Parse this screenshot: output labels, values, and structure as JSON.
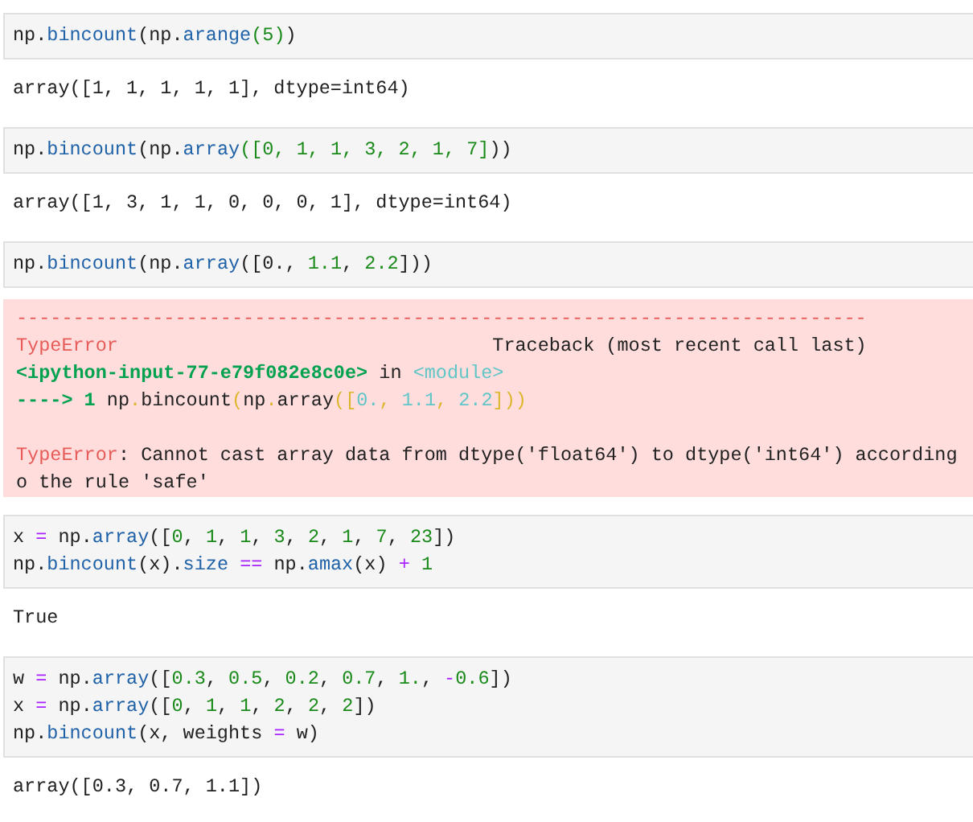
{
  "cells": [
    {
      "input": [
        [
          {
            "kind": "plain",
            "text": "np."
          },
          {
            "kind": "attr",
            "text": "bincount"
          },
          {
            "kind": "plain",
            "text": "(np."
          },
          {
            "kind": "attr",
            "text": "arange"
          },
          {
            "kind": "num",
            "text": "(5)"
          },
          {
            "kind": "plain",
            "text": ")"
          }
        ]
      ],
      "output": {
        "kind": "text",
        "lines": [
          [
            {
              "kind": "plain",
              "text": "array([1, 1, 1, 1, 1], dtype=int64)"
            }
          ]
        ]
      }
    },
    {
      "input": [
        [
          {
            "kind": "plain",
            "text": "np."
          },
          {
            "kind": "attr",
            "text": "bincount"
          },
          {
            "kind": "plain",
            "text": "(np."
          },
          {
            "kind": "attr",
            "text": "array"
          },
          {
            "kind": "num",
            "text": "([0, 1, 1, 3, 2, 1, 7]"
          },
          {
            "kind": "plain",
            "text": "))"
          }
        ]
      ],
      "output": {
        "kind": "text",
        "lines": [
          [
            {
              "kind": "plain",
              "text": "array([1, 3, 1, 1, 0, 0, 0, 1], dtype=int64)"
            }
          ]
        ]
      }
    },
    {
      "input": [
        [
          {
            "kind": "plain",
            "text": "np."
          },
          {
            "kind": "attr",
            "text": "bincount"
          },
          {
            "kind": "plain",
            "text": "(np."
          },
          {
            "kind": "attr",
            "text": "array"
          },
          {
            "kind": "plain",
            "text": "([0., "
          },
          {
            "kind": "num",
            "text": "1.1"
          },
          {
            "kind": "plain",
            "text": ", "
          },
          {
            "kind": "num",
            "text": "2.2"
          },
          {
            "kind": "plain",
            "text": "]))"
          }
        ]
      ],
      "output": {
        "kind": "error",
        "blocks": [
          [
            [
              {
                "kind": "red",
                "text": "---------------------------------------------------------------------------"
              }
            ],
            [
              {
                "kind": "red",
                "text": "TypeError"
              },
              {
                "kind": "plain",
                "text": "                                 Traceback (most recent call last)"
              }
            ],
            [
              {
                "kind": "green",
                "text": "<ipython-input-77-e79f082e8c0e>"
              },
              {
                "kind": "plain",
                "text": " in "
              },
              {
                "kind": "cyan",
                "text": "<module>"
              }
            ],
            [
              {
                "kind": "green",
                "text": "----> 1 "
              },
              {
                "kind": "plain",
                "text": "np"
              },
              {
                "kind": "yellow",
                "text": "."
              },
              {
                "kind": "plain",
                "text": "bincount"
              },
              {
                "kind": "yellow",
                "text": "("
              },
              {
                "kind": "plain",
                "text": "np"
              },
              {
                "kind": "yellow",
                "text": "."
              },
              {
                "kind": "plain",
                "text": "array"
              },
              {
                "kind": "yellow",
                "text": "(["
              },
              {
                "kind": "cyan",
                "text": "0."
              },
              {
                "kind": "yellow",
                "text": ", "
              },
              {
                "kind": "cyan",
                "text": "1.1"
              },
              {
                "kind": "yellow",
                "text": ", "
              },
              {
                "kind": "cyan",
                "text": "2.2"
              },
              {
                "kind": "yellow",
                "text": "]))"
              }
            ]
          ],
          [
            [
              {
                "kind": "red",
                "text": "TypeError"
              },
              {
                "kind": "plain",
                "text": ": Cannot cast array data from dtype('float64') to dtype('int64') according"
              }
            ],
            [
              {
                "kind": "plain",
                "text": "o the rule 'safe'"
              }
            ]
          ]
        ]
      }
    },
    {
      "input": [
        [
          {
            "kind": "plain",
            "text": "x "
          },
          {
            "kind": "op",
            "text": "="
          },
          {
            "kind": "plain",
            "text": " np."
          },
          {
            "kind": "attr",
            "text": "array"
          },
          {
            "kind": "plain",
            "text": "(["
          },
          {
            "kind": "num",
            "text": "0"
          },
          {
            "kind": "plain",
            "text": ", "
          },
          {
            "kind": "num",
            "text": "1"
          },
          {
            "kind": "plain",
            "text": ", "
          },
          {
            "kind": "num",
            "text": "1"
          },
          {
            "kind": "plain",
            "text": ", "
          },
          {
            "kind": "num",
            "text": "3"
          },
          {
            "kind": "plain",
            "text": ", "
          },
          {
            "kind": "num",
            "text": "2"
          },
          {
            "kind": "plain",
            "text": ", "
          },
          {
            "kind": "num",
            "text": "1"
          },
          {
            "kind": "plain",
            "text": ", "
          },
          {
            "kind": "num",
            "text": "7"
          },
          {
            "kind": "plain",
            "text": ", "
          },
          {
            "kind": "num",
            "text": "23"
          },
          {
            "kind": "plain",
            "text": "])"
          }
        ],
        [
          {
            "kind": "plain",
            "text": "np."
          },
          {
            "kind": "attr",
            "text": "bincount"
          },
          {
            "kind": "plain",
            "text": "(x)."
          },
          {
            "kind": "attr",
            "text": "size"
          },
          {
            "kind": "op",
            "text": " =="
          },
          {
            "kind": "plain",
            "text": " np."
          },
          {
            "kind": "attr",
            "text": "amax"
          },
          {
            "kind": "plain",
            "text": "(x) "
          },
          {
            "kind": "op",
            "text": "+ "
          },
          {
            "kind": "num",
            "text": "1"
          }
        ]
      ],
      "output": {
        "kind": "text",
        "lines": [
          [
            {
              "kind": "plain",
              "text": "True"
            }
          ]
        ]
      }
    },
    {
      "input": [
        [
          {
            "kind": "plain",
            "text": "w "
          },
          {
            "kind": "op",
            "text": "="
          },
          {
            "kind": "plain",
            "text": " np."
          },
          {
            "kind": "attr",
            "text": "array"
          },
          {
            "kind": "plain",
            "text": "(["
          },
          {
            "kind": "num",
            "text": "0.3"
          },
          {
            "kind": "plain",
            "text": ", "
          },
          {
            "kind": "num",
            "text": "0.5"
          },
          {
            "kind": "plain",
            "text": ", "
          },
          {
            "kind": "num",
            "text": "0.2"
          },
          {
            "kind": "plain",
            "text": ", "
          },
          {
            "kind": "num",
            "text": "0.7"
          },
          {
            "kind": "plain",
            "text": ", "
          },
          {
            "kind": "num",
            "text": "1."
          },
          {
            "kind": "plain",
            "text": ", "
          },
          {
            "kind": "op",
            "text": "-"
          },
          {
            "kind": "num",
            "text": "0.6"
          },
          {
            "kind": "plain",
            "text": "])"
          }
        ],
        [
          {
            "kind": "plain",
            "text": "x "
          },
          {
            "kind": "op",
            "text": "="
          },
          {
            "kind": "plain",
            "text": " np."
          },
          {
            "kind": "attr",
            "text": "array"
          },
          {
            "kind": "plain",
            "text": "(["
          },
          {
            "kind": "num",
            "text": "0"
          },
          {
            "kind": "plain",
            "text": ", "
          },
          {
            "kind": "num",
            "text": "1"
          },
          {
            "kind": "plain",
            "text": ", "
          },
          {
            "kind": "num",
            "text": "1"
          },
          {
            "kind": "plain",
            "text": ", "
          },
          {
            "kind": "num",
            "text": "2"
          },
          {
            "kind": "plain",
            "text": ", "
          },
          {
            "kind": "num",
            "text": "2"
          },
          {
            "kind": "plain",
            "text": ", "
          },
          {
            "kind": "num",
            "text": "2"
          },
          {
            "kind": "plain",
            "text": "])"
          }
        ],
        [
          {
            "kind": "plain",
            "text": "np."
          },
          {
            "kind": "attr",
            "text": "bincount"
          },
          {
            "kind": "plain",
            "text": "(x, weights "
          },
          {
            "kind": "op",
            "text": "="
          },
          {
            "kind": "plain",
            "text": " w)"
          }
        ]
      ],
      "output": {
        "kind": "text",
        "lines": [
          [
            {
              "kind": "plain",
              "text": "array([0.3, 0.7, 1.1])"
            }
          ]
        ]
      }
    }
  ]
}
